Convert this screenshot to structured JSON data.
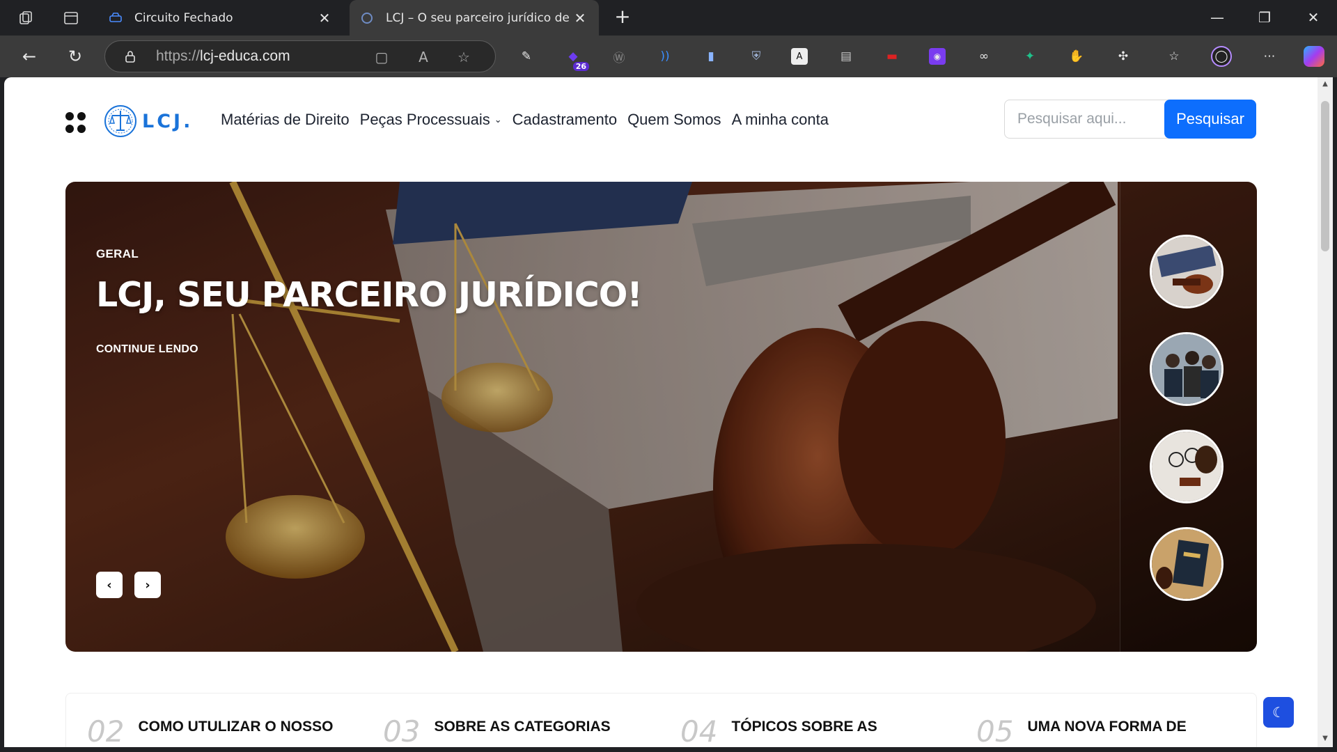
{
  "browser": {
    "tabs": [
      {
        "title": "Circuito Fechado",
        "active": false
      },
      {
        "title": "LCJ – O seu parceiro jurídico de b",
        "active": true
      }
    ],
    "url_scheme": "https://",
    "url_host": "lcj-educa.com",
    "extension_badge": "26"
  },
  "site": {
    "logo_text": "LCJ.",
    "nav": [
      {
        "label": "Matérias de Direito",
        "has_dropdown": false
      },
      {
        "label": "Peças Processuais",
        "has_dropdown": true
      },
      {
        "label": "Cadastramento",
        "has_dropdown": false
      },
      {
        "label": "Quem Somos",
        "has_dropdown": false
      },
      {
        "label": "A minha conta",
        "has_dropdown": false
      }
    ],
    "search": {
      "placeholder": "Pesquisar aqui...",
      "value": "",
      "button_label": "Pesquisar"
    }
  },
  "hero": {
    "category": "GERAL",
    "title": "LCJ, SEU PARCEIRO JURÍDICO!",
    "read_more": "CONTINUE LENDO",
    "prev_icon": "chevron-left-icon",
    "next_icon": "chevron-right-icon",
    "thumbnails": [
      "gavel-thumbnail",
      "people-meeting-thumbnail",
      "glasses-gavel-thumbnail",
      "book-thumbnail"
    ]
  },
  "featured": [
    {
      "num": "02",
      "title": "COMO UTULIZAR O NOSSO"
    },
    {
      "num": "03",
      "title": "SOBRE AS CATEGORIAS"
    },
    {
      "num": "04",
      "title": "TÓPICOS SOBRE AS"
    },
    {
      "num": "05",
      "title": "UMA NOVA FORMA DE"
    }
  ],
  "colors": {
    "brand": "#1a73d9",
    "button": "#0d6efd",
    "theme_toggle": "#1e4fe0"
  }
}
